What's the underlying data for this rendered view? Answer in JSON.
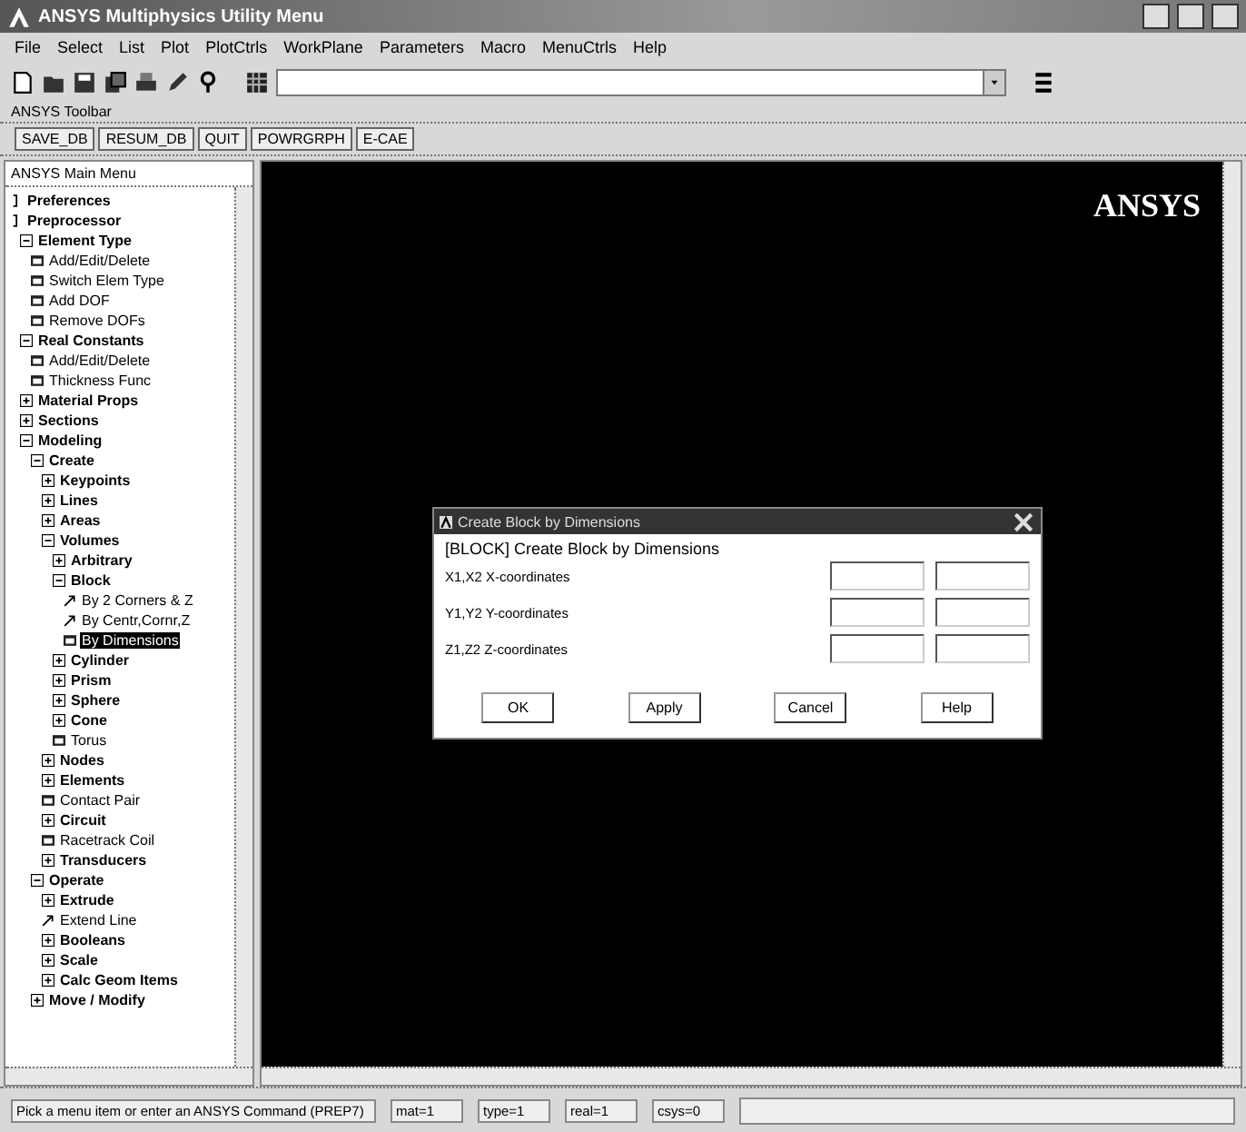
{
  "window": {
    "title": "ANSYS Multiphysics Utility Menu"
  },
  "menu_bar": [
    "File",
    "Select",
    "List",
    "Plot",
    "PlotCtrls",
    "WorkPlane",
    "Parameters",
    "Macro",
    "MenuCtrls",
    "Help"
  ],
  "toolbar_label": "ANSYS Toolbar",
  "toolbar_buttons": [
    "SAVE_DB",
    "RESUM_DB",
    "QUIT",
    "POWRGRPH",
    "E-CAE"
  ],
  "main_menu": {
    "title": "ANSYS Main Menu",
    "items": [
      {
        "label": "Preferences",
        "kind": "top",
        "selected": false
      },
      {
        "label": "Preprocessor",
        "kind": "top",
        "selected": false,
        "children": [
          {
            "label": "Element Type",
            "kind": "folder",
            "expanded": true,
            "selected": false,
            "children": [
              {
                "label": "Add/Edit/Delete",
                "kind": "dialog",
                "selected": false
              },
              {
                "label": "Switch Elem Type",
                "kind": "dialog",
                "selected": false
              },
              {
                "label": "Add DOF",
                "kind": "dialog",
                "selected": false
              },
              {
                "label": "Remove DOFs",
                "kind": "dialog",
                "selected": false
              }
            ]
          },
          {
            "label": "Real Constants",
            "kind": "folder",
            "expanded": true,
            "selected": false,
            "children": [
              {
                "label": "Add/Edit/Delete",
                "kind": "dialog",
                "selected": false
              },
              {
                "label": "Thickness Func",
                "kind": "dialog",
                "selected": false
              }
            ]
          },
          {
            "label": "Material Props",
            "kind": "folder",
            "expanded": false,
            "selected": false
          },
          {
            "label": "Sections",
            "kind": "folder",
            "expanded": false,
            "selected": false
          },
          {
            "label": "Modeling",
            "kind": "folder",
            "expanded": true,
            "selected": false,
            "children": [
              {
                "label": "Create",
                "kind": "folder",
                "expanded": true,
                "selected": false,
                "children": [
                  {
                    "label": "Keypoints",
                    "kind": "folder",
                    "expanded": false,
                    "selected": false
                  },
                  {
                    "label": "Lines",
                    "kind": "folder",
                    "expanded": false,
                    "selected": false
                  },
                  {
                    "label": "Areas",
                    "kind": "folder",
                    "expanded": false,
                    "selected": false
                  },
                  {
                    "label": "Volumes",
                    "kind": "folder",
                    "expanded": true,
                    "selected": false,
                    "children": [
                      {
                        "label": "Arbitrary",
                        "kind": "folder",
                        "expanded": false,
                        "selected": false
                      },
                      {
                        "label": "Block",
                        "kind": "folder",
                        "expanded": true,
                        "selected": false,
                        "children": [
                          {
                            "label": "By 2 Corners & Z",
                            "kind": "pick",
                            "selected": false
                          },
                          {
                            "label": "By Centr,Cornr,Z",
                            "kind": "pick",
                            "selected": false
                          },
                          {
                            "label": "By Dimensions",
                            "kind": "dialog",
                            "selected": true
                          }
                        ]
                      },
                      {
                        "label": "Cylinder",
                        "kind": "folder",
                        "expanded": false,
                        "selected": false
                      },
                      {
                        "label": "Prism",
                        "kind": "folder",
                        "expanded": false,
                        "selected": false
                      },
                      {
                        "label": "Sphere",
                        "kind": "folder",
                        "expanded": false,
                        "selected": false
                      },
                      {
                        "label": "Cone",
                        "kind": "folder",
                        "expanded": false,
                        "selected": false
                      },
                      {
                        "label": "Torus",
                        "kind": "dialog",
                        "selected": false
                      }
                    ]
                  },
                  {
                    "label": "Nodes",
                    "kind": "folder",
                    "expanded": false,
                    "selected": false
                  },
                  {
                    "label": "Elements",
                    "kind": "folder",
                    "expanded": false,
                    "selected": false
                  },
                  {
                    "label": "Contact Pair",
                    "kind": "dialog",
                    "selected": false
                  },
                  {
                    "label": "Circuit",
                    "kind": "folder",
                    "expanded": false,
                    "selected": false
                  },
                  {
                    "label": "Racetrack Coil",
                    "kind": "dialog",
                    "selected": false
                  },
                  {
                    "label": "Transducers",
                    "kind": "folder",
                    "expanded": false,
                    "selected": false
                  }
                ]
              },
              {
                "label": "Operate",
                "kind": "folder",
                "expanded": true,
                "selected": false,
                "children": [
                  {
                    "label": "Extrude",
                    "kind": "folder",
                    "expanded": false,
                    "selected": false
                  },
                  {
                    "label": "Extend Line",
                    "kind": "pick",
                    "selected": false
                  },
                  {
                    "label": "Booleans",
                    "kind": "folder",
                    "expanded": false,
                    "selected": false
                  },
                  {
                    "label": "Scale",
                    "kind": "folder",
                    "expanded": false,
                    "selected": false
                  },
                  {
                    "label": "Calc Geom Items",
                    "kind": "folder",
                    "expanded": false,
                    "selected": false
                  }
                ]
              },
              {
                "label": "Move / Modify",
                "kind": "folder",
                "expanded": false,
                "selected": false
              }
            ]
          }
        ]
      }
    ]
  },
  "graphics": {
    "logo": "ANSYS"
  },
  "dialog": {
    "title": "Create Block by Dimensions",
    "heading": "[BLOCK]  Create Block by Dimensions",
    "rows": [
      {
        "label": "X1,X2  X-coordinates"
      },
      {
        "label": "Y1,Y2  Y-coordinates"
      },
      {
        "label": "Z1,Z2  Z-coordinates"
      }
    ],
    "buttons": [
      "OK",
      "Apply",
      "Cancel",
      "Help"
    ]
  },
  "status_bar": {
    "prompt": "Pick a menu item or enter an ANSYS Command (PREP7)",
    "fields": [
      "mat=1",
      "type=1",
      "real=1",
      "csys=0"
    ]
  }
}
